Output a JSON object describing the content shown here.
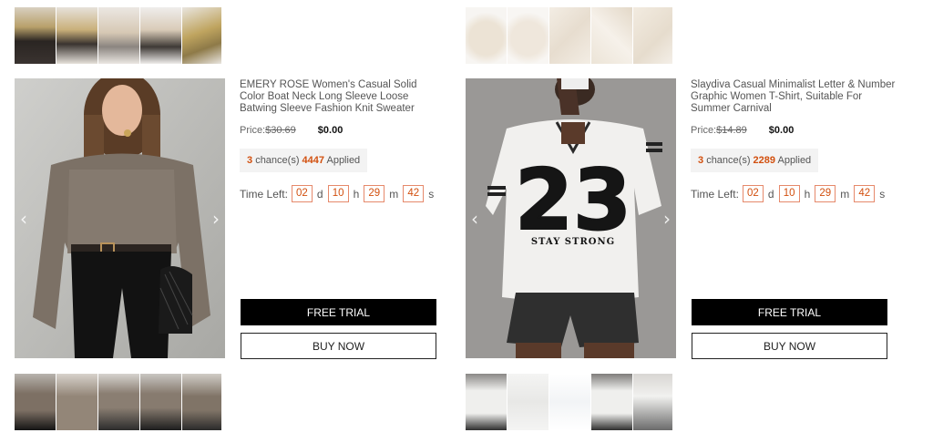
{
  "products": [
    {
      "title": "EMERY ROSE Women's Casual Solid Color Boat Neck Long Sleeve Loose Batwing Sleeve Fashion Knit Sweater",
      "price_label": "Price:",
      "old_price": "$30.69",
      "new_price": "$0.00",
      "chances": "3",
      "chance_text": "chance(s)",
      "applied_count": "4447",
      "applied_text": "Applied",
      "time_left_label": "Time Left:",
      "timer": {
        "d": "02",
        "h": "10",
        "m": "29",
        "s": "42"
      },
      "free_trial_label": "FREE TRIAL",
      "buy_now_label": "BUY NOW"
    },
    {
      "title": "Slaydiva Casual Minimalist Letter & Number Graphic Women T-Shirt, Suitable For Summer Carnival",
      "price_label": "Price:",
      "old_price": "$14.89",
      "new_price": "$0.00",
      "chances": "3",
      "chance_text": "chance(s)",
      "applied_count": "2289",
      "applied_text": "Applied",
      "time_left_label": "Time Left:",
      "timer": {
        "d": "02",
        "h": "10",
        "m": "29",
        "s": "42"
      },
      "free_trial_label": "FREE TRIAL",
      "buy_now_label": "BUY NOW"
    }
  ],
  "units": {
    "d": "d",
    "h": "h",
    "m": "m",
    "s": "s"
  },
  "shirt_print": {
    "number": "23",
    "slogan": "STAY STRONG"
  },
  "icons": {
    "prev": "chevron-left-icon",
    "next": "chevron-right-icon"
  }
}
